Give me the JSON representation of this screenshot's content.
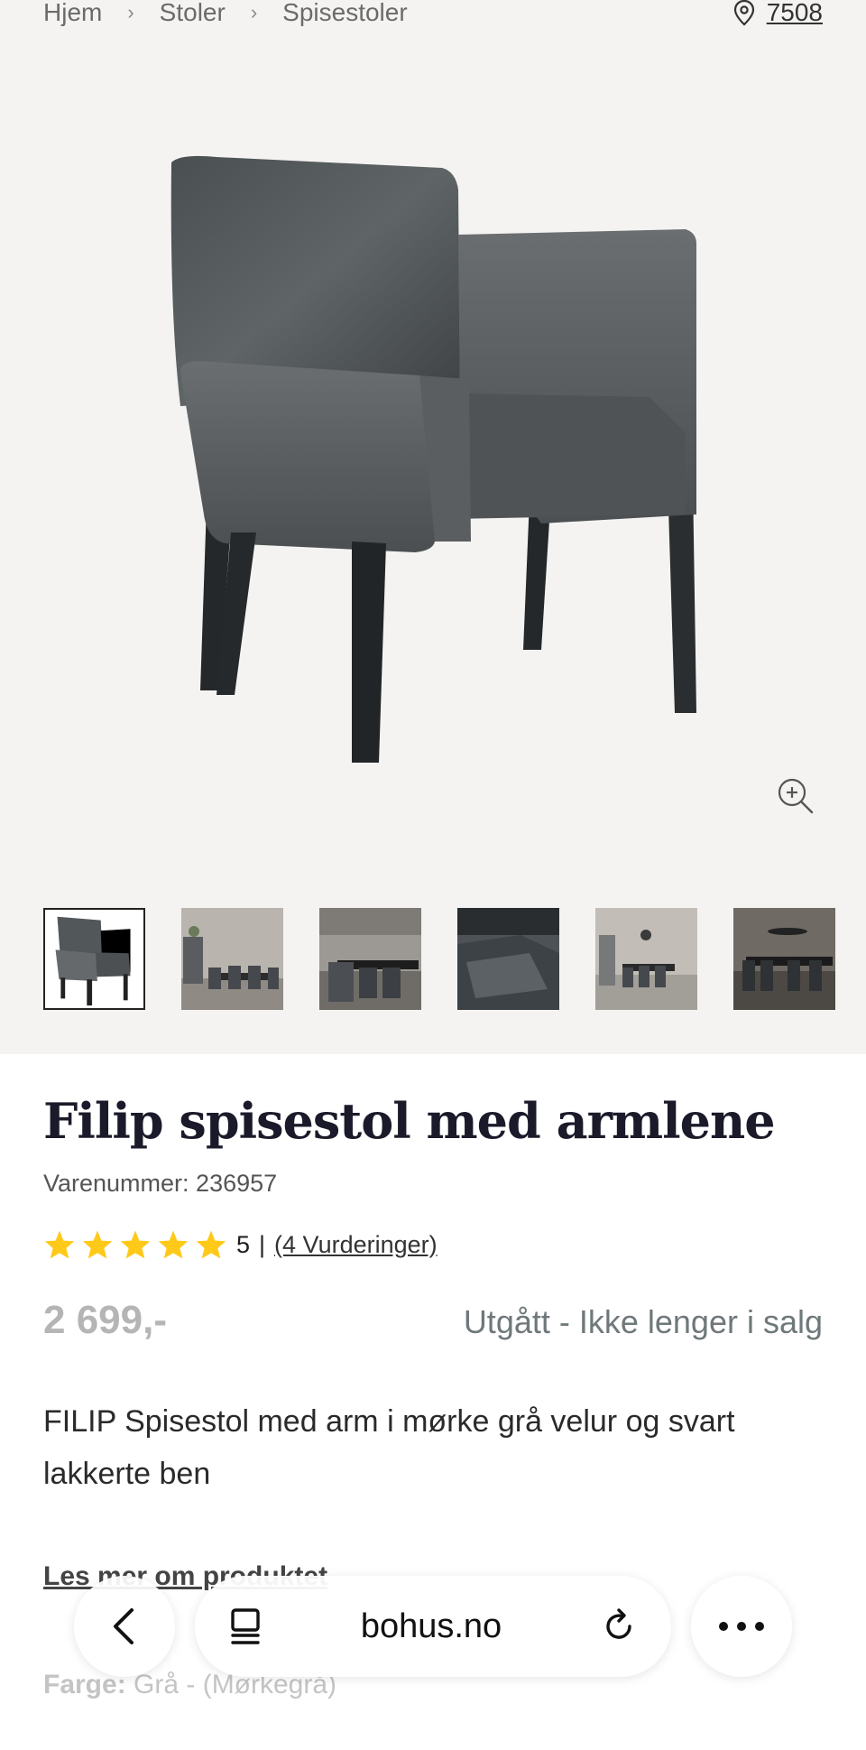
{
  "breadcrumb": {
    "items": [
      "Hjem",
      "Stoler",
      "Spisestoler"
    ],
    "separator": ">"
  },
  "store": {
    "icon": "location-pin-icon",
    "number": "7508"
  },
  "gallery": {
    "thumbnail_count": 6,
    "zoom_icon": "zoom-in-icon"
  },
  "product": {
    "title": "Filip spisestol med armlene",
    "sku": "Varenummer: 236957",
    "rating_value": "5",
    "rating_separator": "|",
    "stars": 5,
    "reviews": "(4 Vurderinger)",
    "price": "2 699,-",
    "status": "Utgått - Ikke lenger i salg",
    "description": "FILIP Spisestol med arm i mørke grå velur og svart lakkerte ben",
    "read_more": "Les mer om produktet",
    "color_label": "Farge:",
    "color_value": "Grå - (Mørkegrå)"
  },
  "browser": {
    "domain": "bohus.no",
    "back_icon": "back-chevron-icon",
    "tabs_icon": "reader-icon",
    "reload_icon": "reload-icon",
    "more_icon": "more-dots-icon"
  },
  "colors": {
    "star": "#ffc919",
    "price": "#b5b5b5",
    "status": "#6f787a",
    "title": "#1a1a2a"
  }
}
